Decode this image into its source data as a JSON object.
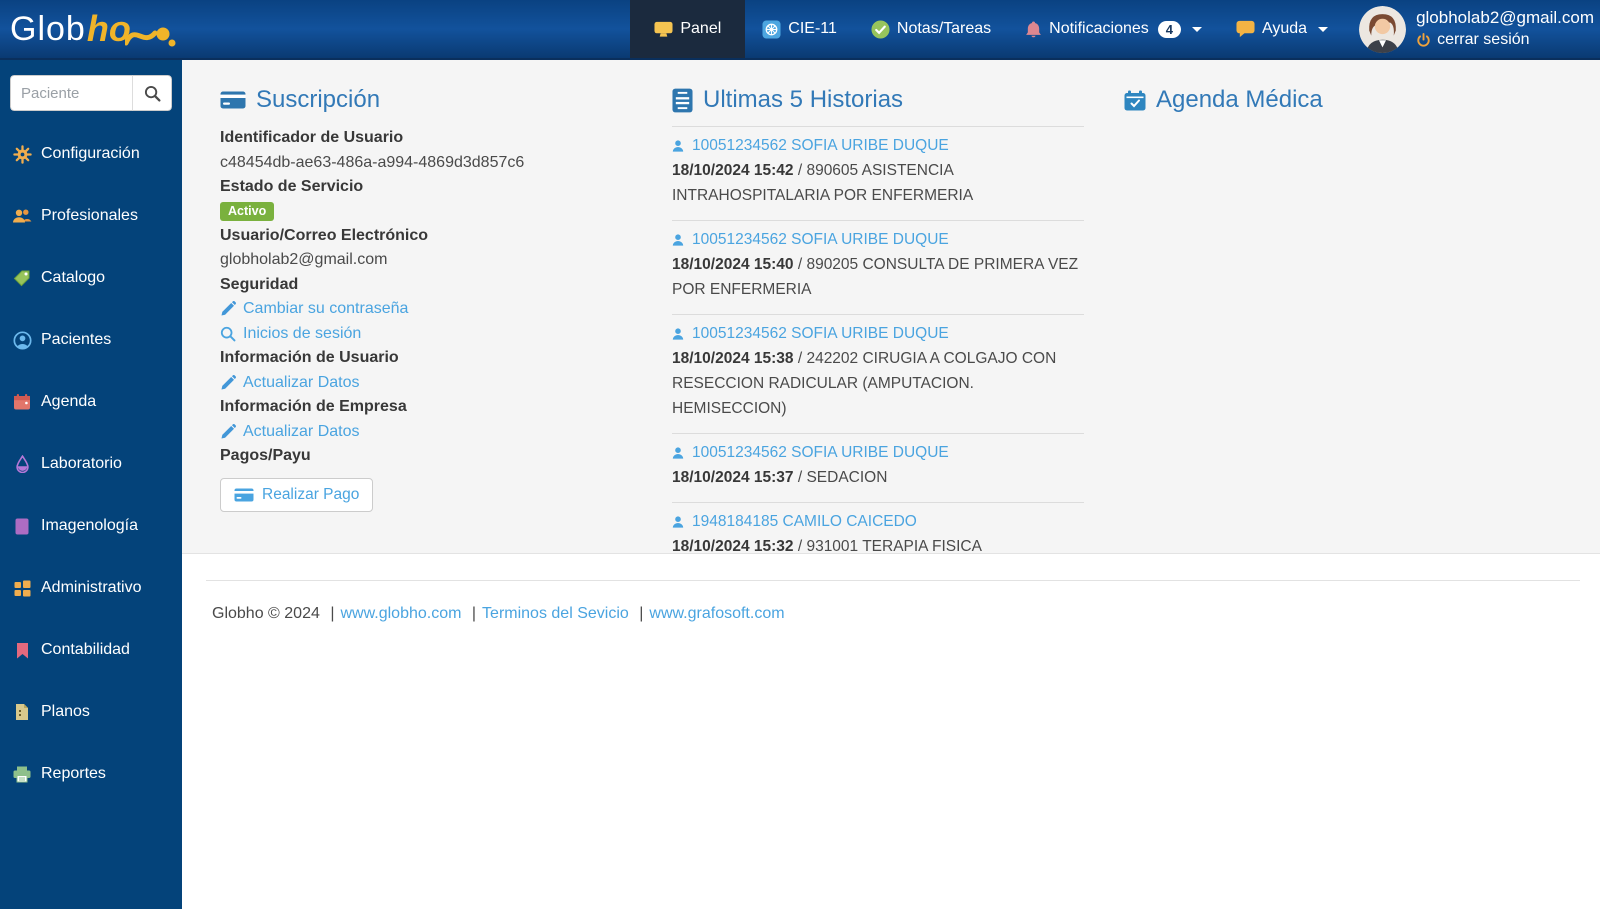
{
  "navbar": {
    "logo": {
      "part1": "Glob",
      "part2": "ho"
    },
    "items": [
      {
        "label": "Panel",
        "active": true
      },
      {
        "label": "CIE-11"
      },
      {
        "label": "Notas/Tareas"
      },
      {
        "label": "Notificaciones",
        "badge": "4"
      },
      {
        "label": "Ayuda"
      }
    ],
    "user": {
      "email": "globholab2@gmail.com",
      "logout_label": "cerrar sesión"
    }
  },
  "sidebar": {
    "search": {
      "placeholder": "Paciente"
    },
    "items": [
      {
        "label": "Configuración",
        "icon": "gear-icon"
      },
      {
        "label": "Profesionales",
        "icon": "users-icon"
      },
      {
        "label": "Catalogo",
        "icon": "tag-icon"
      },
      {
        "label": "Pacientes",
        "icon": "patient-icon"
      },
      {
        "label": "Agenda",
        "icon": "calendar-icon"
      },
      {
        "label": "Laboratorio",
        "icon": "droplet-icon"
      },
      {
        "label": "Imagenología",
        "icon": "image-icon"
      },
      {
        "label": "Administrativo",
        "icon": "grid-icon"
      },
      {
        "label": "Contabilidad",
        "icon": "bookmark-icon"
      },
      {
        "label": "Planos",
        "icon": "file-icon"
      },
      {
        "label": "Reportes",
        "icon": "printer-icon"
      }
    ]
  },
  "subscription": {
    "title": "Suscripción",
    "user_id_label": "Identificador de Usuario",
    "user_id": "c48454db-ae63-486a-a994-4869d3d857c6",
    "service_status_label": "Estado de Servicio",
    "status_badge": "Activo",
    "email_label": "Usuario/Correo Electrónico",
    "email": "globholab2@gmail.com",
    "security_label": "Seguridad",
    "change_password_link": "Cambiar su contraseña",
    "logins_link": "Inicios de sesión",
    "user_info_label": "Información de Usuario",
    "update_user_link": "Actualizar Datos",
    "company_info_label": "Información de Empresa",
    "update_company_link": "Actualizar Datos",
    "payments_label": "Pagos/Payu",
    "pay_button": "Realizar Pago"
  },
  "histories": {
    "title": "Ultimas 5 Historias",
    "items": [
      {
        "patient": "10051234562 SOFIA URIBE DUQUE",
        "datetime": "18/10/2024 15:42",
        "detail": " / 890605 ASISTENCIA INTRAHOSPITALARIA POR ENFERMERIA"
      },
      {
        "patient": "10051234562 SOFIA URIBE DUQUE",
        "datetime": "18/10/2024 15:40",
        "detail": " / 890205 CONSULTA DE PRIMERA VEZ POR ENFERMERIA"
      },
      {
        "patient": "10051234562 SOFIA URIBE DUQUE",
        "datetime": "18/10/2024 15:38",
        "detail": " / 242202 CIRUGIA A COLGAJO CON RESECCION RADICULAR (AMPUTACION. HEMISECCION)"
      },
      {
        "patient": "10051234562 SOFIA URIBE DUQUE",
        "datetime": "18/10/2024 15:37",
        "detail": " / SEDACION"
      },
      {
        "patient": "1948184185 CAMILO CAICEDO",
        "datetime": "18/10/2024 15:32",
        "detail": " / 931001 TERAPIA FISICA"
      }
    ]
  },
  "agenda": {
    "title": "Agenda Médica"
  },
  "footer": {
    "copyright": "Globho © 2024",
    "sep": "|",
    "links": [
      "www.globho.com",
      "Terminos del Sevicio",
      "www.grafosoft.com"
    ]
  },
  "colors": {
    "navbar_blue": "#12529c",
    "active_tab": "#1b2a3e",
    "sidebar_navy": "#04437a",
    "header_blue": "#3279b7",
    "link_blue": "#4aa4e0",
    "status_green": "#7ab13e",
    "logo_yellow": "#f0b429",
    "content_gray": "#f5f5f5"
  }
}
